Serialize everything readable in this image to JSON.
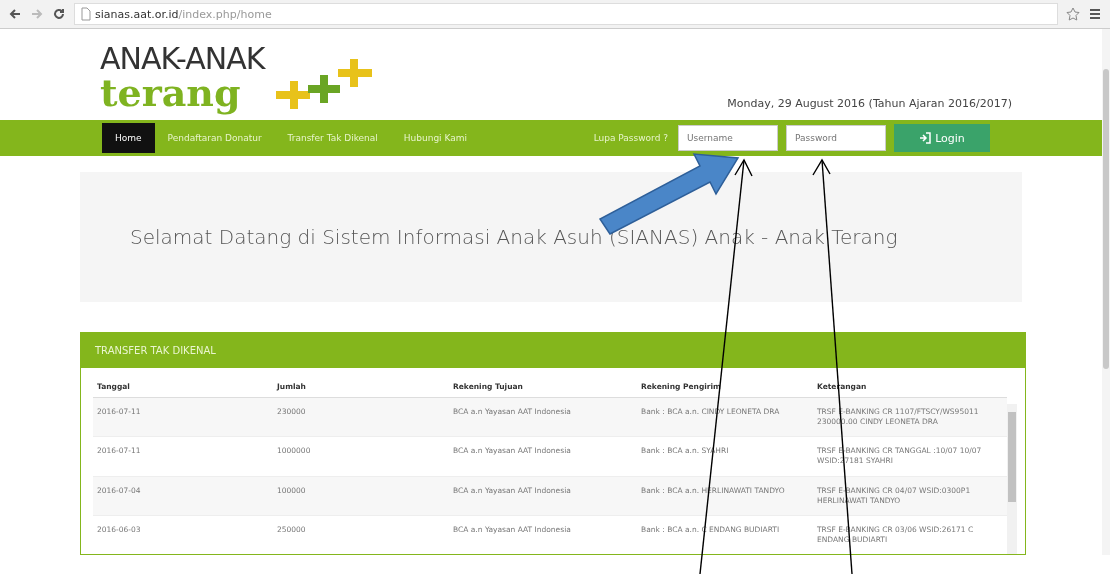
{
  "browser": {
    "url_host": "sianas.aat.or.id",
    "url_path": "/index.php/home"
  },
  "logo": {
    "line_1": "ANAK-ANAK",
    "line_2": "terang"
  },
  "date": "Monday, 29 August 2016 (Tahun Ajaran 2016/2017)",
  "nav": {
    "items": [
      {
        "label": "Home",
        "selected": true
      },
      {
        "label": "Pendaftaran Donatur",
        "selected": false
      },
      {
        "label": "Transfer Tak Dikenal",
        "selected": false
      },
      {
        "label": "Hubungi Kami",
        "selected": false
      }
    ],
    "forgot_link": "Lupa Password ?",
    "username": {
      "placeholder": "Username"
    },
    "password": {
      "placeholder": "Password"
    },
    "login_button": "Login"
  },
  "welcome": "Selamat Datang di Sistem Informasi Anak Asuh (SIANAS) Anak - Anak Terang",
  "panel": {
    "title": "TRANSFER TAK DIKENAL",
    "table": {
      "columns": [
        "Tanggal",
        "Jumlah",
        "Rekening Tujuan",
        "Rekening Pengirim",
        "Keterangan"
      ],
      "rows": [
        [
          "2016-07-11",
          "230000",
          "BCA a.n Yayasan AAT Indonesia",
          "Bank : BCA a.n. CINDY LEONETA DRA",
          "TRSF E-BANKING CR 1107/FTSCY/WS95011 230000.00 CINDY LEONETA DRA"
        ],
        [
          "2016-07-11",
          "1000000",
          "BCA a.n Yayasan AAT Indonesia",
          "Bank : BCA a.n. SYAHRI",
          "TRSF E-BANKING CR TANGGAL :10/07 10/07 WSID:27181 SYAHRI"
        ],
        [
          "2016-07-04",
          "100000",
          "BCA a.n Yayasan AAT Indonesia",
          "Bank : BCA a.n. HERLINAWATI TANDYO",
          "TRSF E-BANKING CR 04/07 WSID:0300P1 HERLINAWATI TANDYO"
        ],
        [
          "2016-06-03",
          "250000",
          "BCA a.n Yayasan AAT Indonesia",
          "Bank : BCA a.n. C ENDANG BUDIARTI",
          "TRSF E-BANKING CR 03/06 WSID:26171 C ENDANG BUDIARTI"
        ]
      ]
    }
  }
}
